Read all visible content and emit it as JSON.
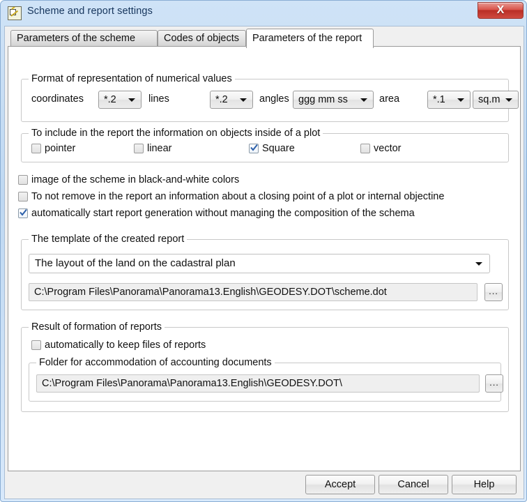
{
  "window": {
    "title": "Scheme and report settings",
    "icon": "scheme-report-icon",
    "close_label": "X"
  },
  "tabs": [
    {
      "label": "Parameters of the scheme",
      "active": false
    },
    {
      "label": "Codes of objects",
      "active": false
    },
    {
      "label": "Parameters of the report",
      "active": true
    }
  ],
  "format_group": {
    "legend": "Format of representation of numerical values",
    "fields": [
      {
        "label": "coordinates",
        "value": "*.2"
      },
      {
        "label": "lines",
        "value": "*.2"
      },
      {
        "label": "angles",
        "value": "ggg mm ss"
      },
      {
        "label": "area",
        "value": "*.1"
      }
    ],
    "area_unit": "sq.m"
  },
  "include_group": {
    "legend": "To include in the report the information on objects inside of a plot",
    "options": [
      {
        "label": "pointer",
        "checked": false
      },
      {
        "label": "linear",
        "checked": false
      },
      {
        "label": "Square",
        "checked": true
      },
      {
        "label": "vector",
        "checked": false
      }
    ]
  },
  "standalone_options": [
    {
      "label": "image of the scheme in black-and-white colors",
      "checked": false
    },
    {
      "label": "To not remove in the report an information about a closing point of a plot or internal objectine",
      "checked": false
    },
    {
      "label": "automatically start report generation without managing the composition of the schema",
      "checked": true
    }
  ],
  "template_group": {
    "legend": "The template of the created report",
    "selected_template": "The layout of the land on the cadastral plan",
    "template_path": "C:\\Program Files\\Panorama\\Panorama13.English\\GEODESY.DOT\\scheme.dot",
    "browse_label": "..."
  },
  "result_group": {
    "legend": "Result of formation of reports",
    "keep_files": {
      "label": "automatically to keep files of reports",
      "checked": false
    },
    "folder_group": {
      "legend": "Folder for accommodation of accounting documents",
      "folder_path": "C:\\Program Files\\Panorama\\Panorama13.English\\GEODESY.DOT\\",
      "browse_label": "..."
    }
  },
  "buttons": [
    {
      "label": "Accept"
    },
    {
      "label": "Cancel"
    },
    {
      "label": "Help"
    }
  ],
  "colors": {
    "titlebar_blue": "#cfe3f7",
    "close_red": "#b92e26",
    "check_blue": "#2b5faa",
    "tab_active_bg": "#ffffff",
    "page_bg": "#ffffff"
  }
}
